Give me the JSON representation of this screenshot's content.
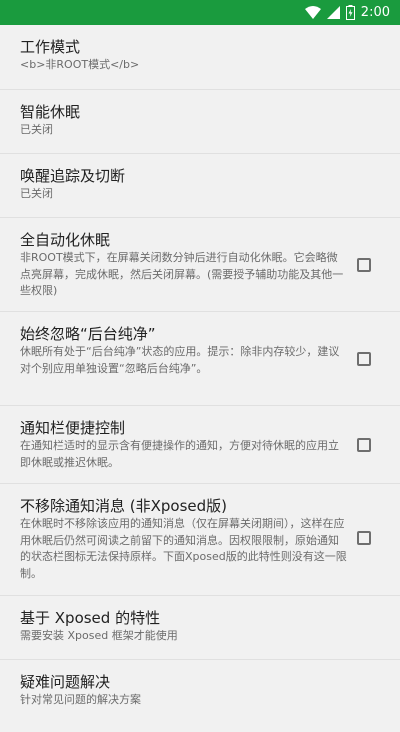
{
  "status_bar": {
    "time": "2:00",
    "icons": [
      "wifi-icon",
      "cell-signal-icon",
      "battery-charging-icon"
    ],
    "background": "#1a9b3e"
  },
  "settings": [
    {
      "title": "工作模式",
      "summary": "<b>非ROOT模式</b>",
      "checkbox": null
    },
    {
      "title": "智能休眠",
      "summary": "已关闭",
      "checkbox": null
    },
    {
      "title": "唤醒追踪及切断",
      "summary": "已关闭",
      "checkbox": null
    },
    {
      "title": "全自动化休眠",
      "summary": "非ROOT模式下，在屏幕关闭数分钟后进行自动化休眠。它会略微点亮屏幕，完成休眠，然后关闭屏幕。(需要授予辅助功能及其他一些权限)",
      "checkbox": false
    },
    {
      "title": "始终忽略“后台纯净”",
      "summary": "休眠所有处于“后台纯净”状态的应用。提示：除非内存较少，建议对个别应用单独设置“忽略后台纯净”。",
      "checkbox": false
    },
    {
      "title": "通知栏便捷控制",
      "summary": "在通知栏适时的显示含有便捷操作的通知，方便对待休眠的应用立即休眠或推迟休眠。",
      "checkbox": false
    },
    {
      "title": "不移除通知消息 (非Xposed版)",
      "summary": "在休眠时不移除该应用的通知消息（仅在屏幕关闭期间），这样在应用休眠后仍然可阅读之前留下的通知消息。因权限限制，原始通知的状态栏图标无法保持原样。下面Xposed版的此特性则没有这一限制。",
      "checkbox": false
    },
    {
      "title": "基于 Xposed 的特性",
      "summary": "需要安装 Xposed 框架才能使用",
      "checkbox": null
    },
    {
      "title": "疑难问题解决",
      "summary": "针对常见问题的解决方案",
      "checkbox": null
    }
  ]
}
